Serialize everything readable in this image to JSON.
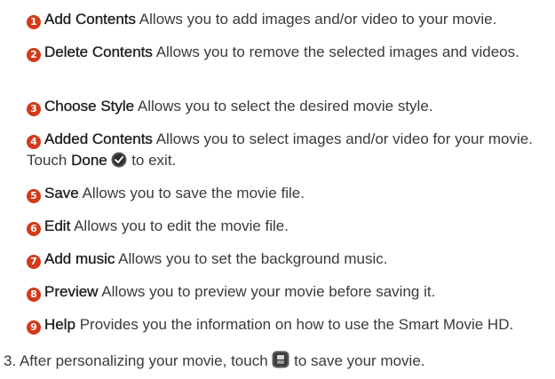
{
  "items": [
    {
      "num": "1",
      "term": "Add Contents",
      "desc": " Allows you to add images and/or video to your movie."
    },
    {
      "num": "2",
      "term": "Delete Contents",
      "desc": " Allows you to remove the selected images and videos."
    },
    {
      "num": "3",
      "term": "Choose Style",
      "desc": " Allows you to select the desired movie style."
    },
    {
      "num": "4",
      "term": "Added Contents",
      "desc": " Allows you to select images and/or video for your movie. Touch ",
      "term2": "Done",
      "desc2": " to exit."
    },
    {
      "num": "5",
      "term": "Save",
      "desc": " Allows you to save the movie file."
    },
    {
      "num": "6",
      "term": "Edit",
      "desc": " Allows you to edit the movie file."
    },
    {
      "num": "7",
      "term": "Add music",
      "desc": " Allows you to set the background music."
    },
    {
      "num": "8",
      "term": "Preview",
      "desc": " Allows you to preview your movie before saving it."
    },
    {
      "num": "9",
      "term": "Help",
      "desc": " Provides you the information on how to use the Smart Movie HD."
    }
  ],
  "step3": {
    "before": "3. After personalizing your movie, touch ",
    "after": " to save your movie."
  },
  "icons": {
    "done": "checkmark-circle-icon",
    "save": "save-icon"
  },
  "colors": {
    "badge": "#d23a1a",
    "text": "#3a3a3a"
  }
}
